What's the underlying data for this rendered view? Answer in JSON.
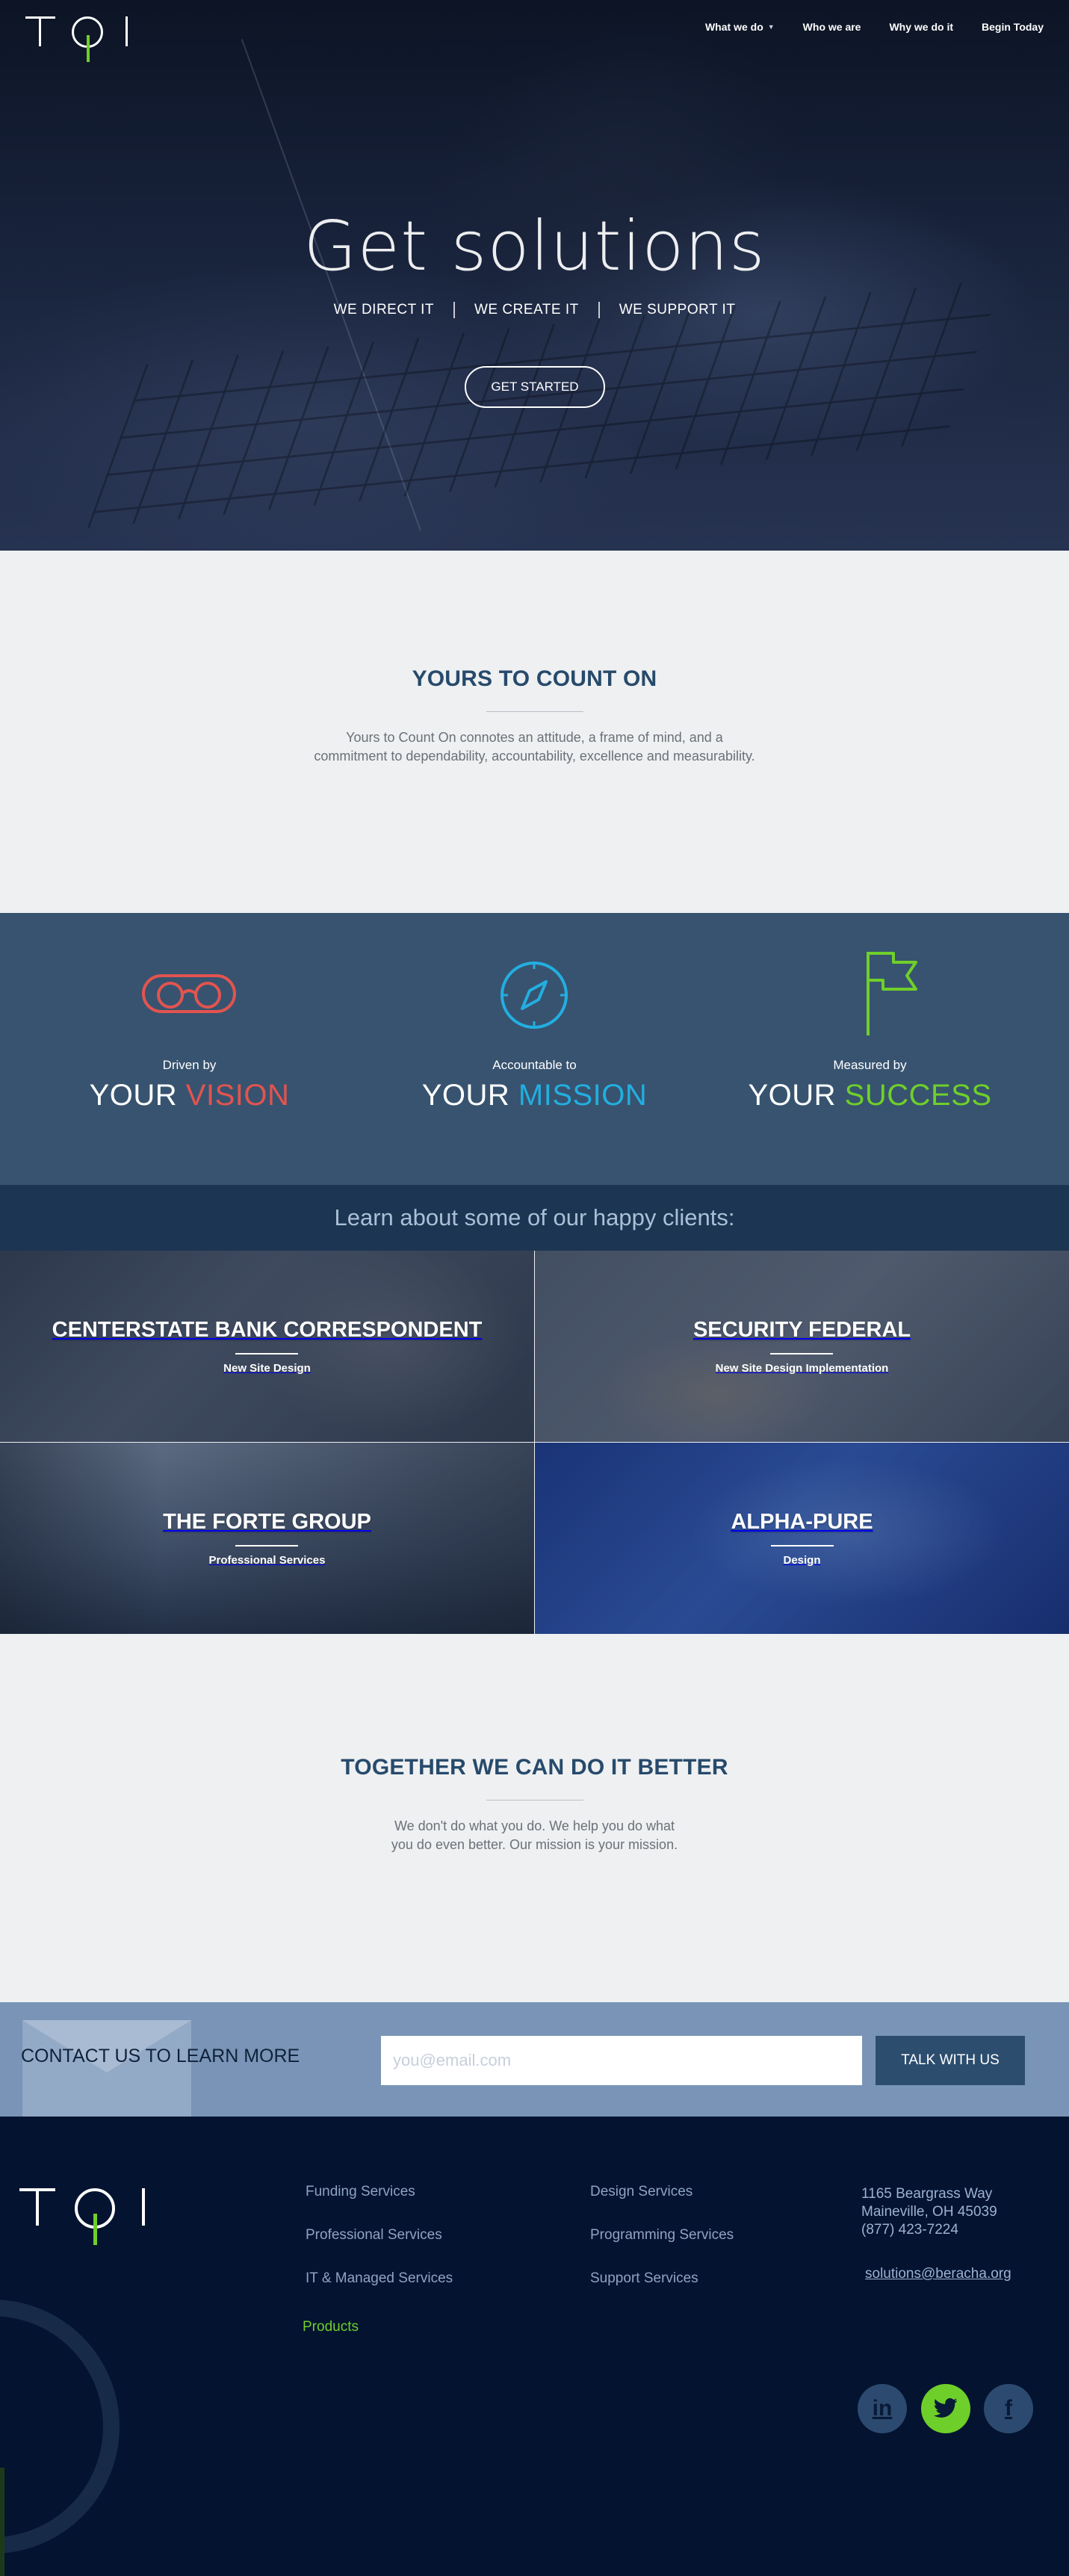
{
  "brand": {
    "logo_text": "TQI",
    "accent_green": "#6fcf2a",
    "navy": "#031330",
    "slate": "#37536f"
  },
  "nav": {
    "items": [
      {
        "label": "What we do",
        "has_caret": true
      },
      {
        "label": "Who we are"
      },
      {
        "label": "Why we do it"
      },
      {
        "label": "Begin Today"
      }
    ]
  },
  "hero": {
    "title": "Get solutions",
    "tags": [
      "WE DIRECT IT",
      "WE CREATE IT",
      "WE SUPPORT IT"
    ],
    "cta": "GET STARTED"
  },
  "intro": {
    "heading": "YOURS TO COUNT ON",
    "body_line1": "Yours to Count On connotes an attitude, a frame of mind, and a",
    "body_line2": "commitment to dependability, accountability, excellence and measurability."
  },
  "values": [
    {
      "small": "Driven by",
      "prefix": "YOUR",
      "word": "VISION",
      "color": "#e2544f",
      "icon": "glasses-icon"
    },
    {
      "small": "Accountable to",
      "prefix": "YOUR",
      "word": "MISSION",
      "color": "#23aee0",
      "icon": "compass-icon"
    },
    {
      "small": "Measured by",
      "prefix": "YOUR",
      "word": "SUCCESS",
      "color": "#6fcf2a",
      "icon": "flag-icon"
    }
  ],
  "clients": {
    "heading": "Learn about some of our happy clients:",
    "tiles": [
      {
        "name": "CENTERSTATE BANK CORRESPONDENT",
        "service": "New Site Design"
      },
      {
        "name": "SECURITY FEDERAL",
        "service": "New Site Design Implementation"
      },
      {
        "name": "THE FORTE GROUP",
        "service": "Professional Services"
      },
      {
        "name": "ALPHA-PURE",
        "service": "Design"
      }
    ]
  },
  "together": {
    "heading": "TOGETHER WE CAN DO IT BETTER",
    "body_line1": "We don't do what you do. We help you do what",
    "body_line2": "you do even better. Our mission is your mission."
  },
  "contact": {
    "label": "CONTACT US TO LEARN MORE",
    "email_placeholder": "you@email.com",
    "email_value": "",
    "button": "TALK WITH US"
  },
  "footer": {
    "col1": [
      "Funding Services",
      "Professional Services",
      "IT & Managed Services"
    ],
    "col2": [
      "Design Services",
      "Programming Services",
      "Support Services"
    ],
    "products": "Products",
    "address_line1": "1165 Beargrass Way",
    "address_line2": "Maineville, OH 45039",
    "phone": "(877) 423-7224",
    "email": "solutions@beracha.org",
    "social": [
      {
        "icon": "linkedin-icon",
        "glyph": "in"
      },
      {
        "icon": "twitter-icon",
        "glyph": "🐦"
      },
      {
        "icon": "facebook-icon",
        "glyph": "f"
      }
    ]
  }
}
